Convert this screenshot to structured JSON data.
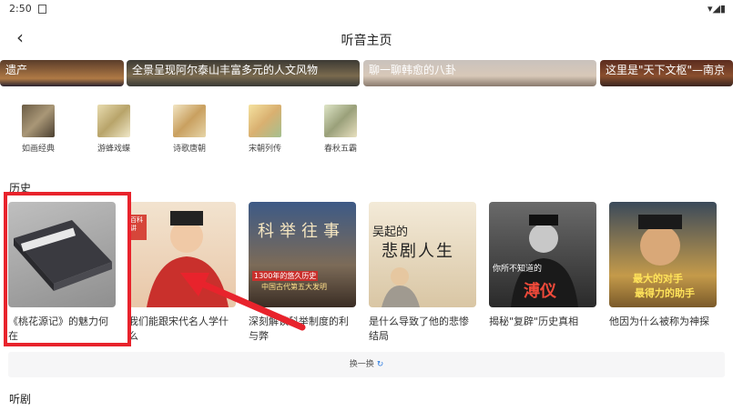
{
  "status_bar": {
    "time": "2:50",
    "icons": "▾◢▮"
  },
  "header": {
    "back_icon": "‹",
    "title": "听音主页"
  },
  "banners": [
    {
      "text": "遗产"
    },
    {
      "text": "全景呈现阿尔泰山丰富多元的人文风物"
    },
    {
      "text": "聊一聊韩愈的八卦"
    },
    {
      "text": "这里是\"天下文枢\"—南京"
    }
  ],
  "categories": [
    {
      "label": "如画经典",
      "color": "#8b7b60"
    },
    {
      "label": "游蜂戏蝶",
      "color": "#b8a46a"
    },
    {
      "label": "诗歌唐朝",
      "color": "#c9a060"
    },
    {
      "label": "宋朝列传",
      "color": "#d9b070"
    },
    {
      "label": "春秋五霸",
      "color": "#9aa07a"
    }
  ],
  "history": {
    "title": "历史",
    "cards": [
      {
        "caption": "《桃花源记》的魅力何在"
      },
      {
        "caption": "我们能跟宋代名人学什么",
        "badge": "百科讲",
        "color": "#d6463a"
      },
      {
        "caption": "深刻解读科举制度的利与弊",
        "overlay": "科举往事",
        "sub1": "1300年的悠久历史",
        "sub2": "中国古代第五大发明"
      },
      {
        "caption": "是什么导致了他的悲惨结局",
        "overlay": "吴起的",
        "overlay2": "悲剧人生"
      },
      {
        "caption": "揭秘\"复辟\"历史真相",
        "overlay": "你所不知道的",
        "overlay2": "溥仪"
      },
      {
        "caption": "他因为什么被称为神探",
        "overlay": "最大的对手",
        "overlay2": "最得力的助手"
      }
    ]
  },
  "refresh": {
    "label": "换一换",
    "icon": "↻"
  },
  "drama": {
    "title": "听剧"
  }
}
